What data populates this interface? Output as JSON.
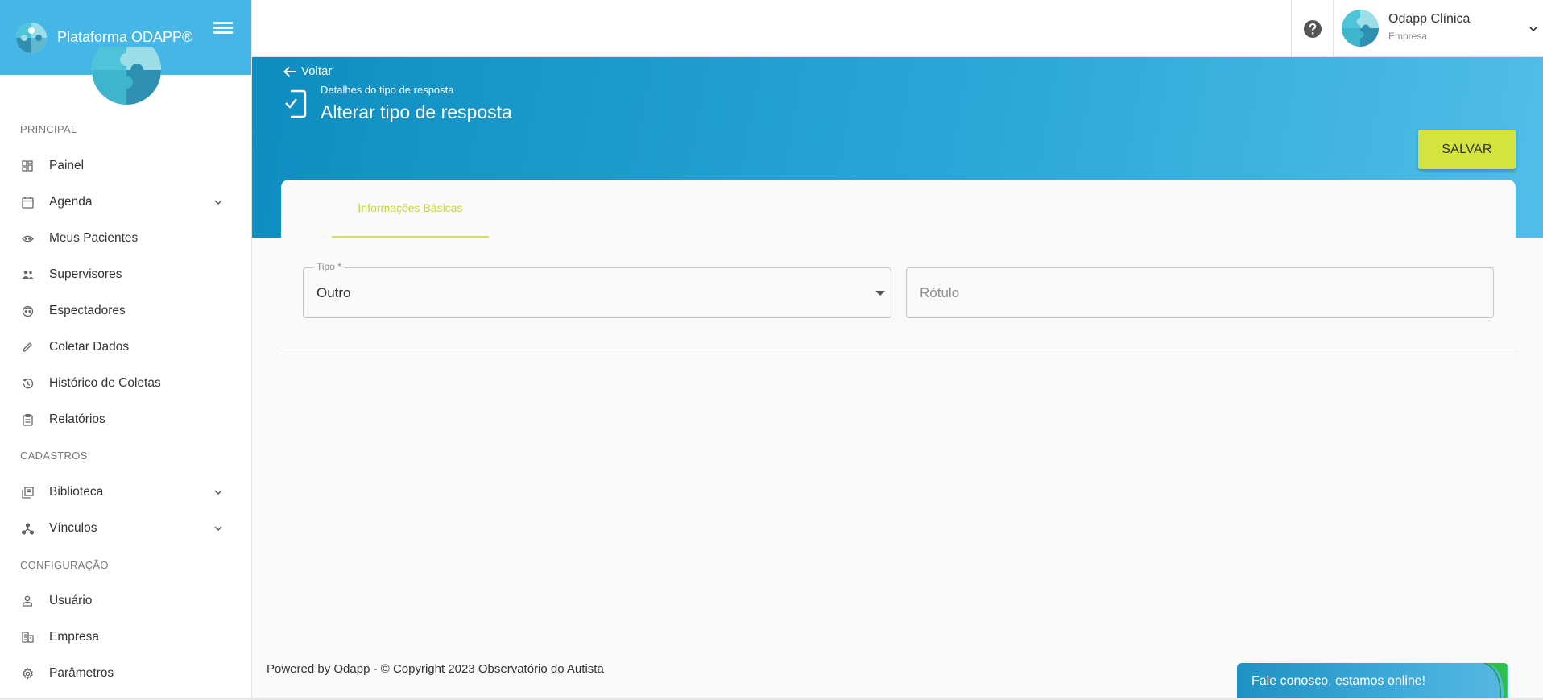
{
  "app": {
    "title": "Plataforma ODAPP®"
  },
  "sidebar": {
    "sections": [
      {
        "label": "PRINCIPAL"
      },
      {
        "label": "CADASTROS"
      },
      {
        "label": "CONFIGURAÇÃO"
      }
    ],
    "items": [
      {
        "label": "Painel",
        "icon": "dashboard-icon"
      },
      {
        "label": "Agenda",
        "icon": "calendar-icon",
        "expandable": true
      },
      {
        "label": "Meus Pacientes",
        "icon": "face-icon"
      },
      {
        "label": "Supervisores",
        "icon": "people-icon"
      },
      {
        "label": "Espectadores",
        "icon": "face-outline-icon"
      },
      {
        "label": "Coletar Dados",
        "icon": "pencil-icon"
      },
      {
        "label": "Histórico de Coletas",
        "icon": "history-icon"
      },
      {
        "label": "Relatórios",
        "icon": "clipboard-icon"
      },
      {
        "label": "Biblioteca",
        "icon": "library-icon",
        "expandable": true
      },
      {
        "label": "Vínculos",
        "icon": "network-icon",
        "expandable": true
      },
      {
        "label": "Usuário",
        "icon": "person-icon"
      },
      {
        "label": "Empresa",
        "icon": "building-icon"
      },
      {
        "label": "Parâmetros",
        "icon": "settings-icon"
      }
    ]
  },
  "topbar": {
    "user_name": "Odapp Clínica",
    "user_role": "Empresa"
  },
  "header": {
    "back_label": "Voltar",
    "subtitle": "Detalhes do tipo de resposta",
    "title": "Alterar tipo de resposta",
    "save_label": "SALVAR"
  },
  "tabs": [
    {
      "label": "Informações Básicas",
      "active": true
    }
  ],
  "form": {
    "tipo": {
      "label": "Tipo *",
      "value": "Outro"
    },
    "rotulo": {
      "placeholder": "Rótulo",
      "value": ""
    }
  },
  "footer": {
    "text": "Powered by Odapp - © Copyright 2023 Observatório do Autista"
  },
  "chat": {
    "label": "Fale conosco, estamos online!"
  },
  "colors": {
    "brand_blue": "#45b6e5",
    "accent_green": "#d3e33f",
    "banner_dark": "#0e8dc0"
  }
}
